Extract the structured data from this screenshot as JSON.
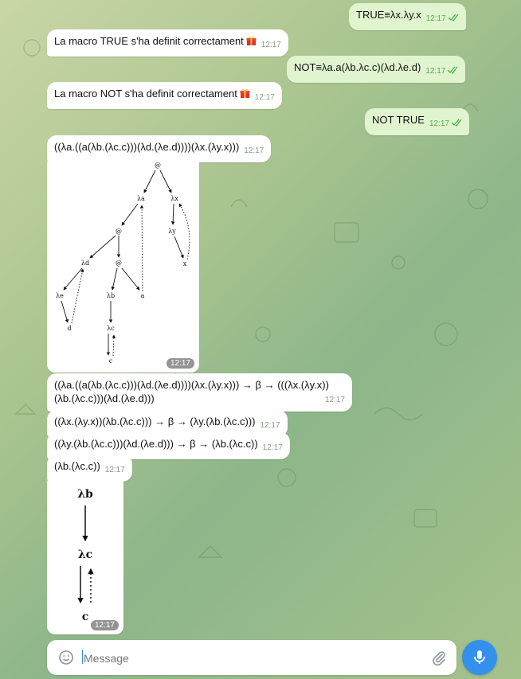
{
  "messages": [
    {
      "dir": "out",
      "text": "TRUE≡λx.λy.x",
      "time": "12:17"
    },
    {
      "dir": "in",
      "text": "La macro TRUE s'ha definit correctament",
      "time": "12:17"
    },
    {
      "dir": "out",
      "text": "NOT≡λa.a(λb.λc.c)(λd.λe.d)",
      "time": "12:17"
    },
    {
      "dir": "in",
      "text": "La macro NOT s'ha definit correctament",
      "time": "12:17"
    },
    {
      "dir": "out",
      "text": "NOT TRUE",
      "time": "12:17"
    },
    {
      "dir": "in",
      "text": "((λa.((a(λb.(λc.c)))(λd.(λe.d))))(λx.(λy.x)))",
      "time": "12:17"
    },
    {
      "dir": "in",
      "text": "((λa.((a(λb.(λc.c)))(λd.(λe.d))))(λx.(λy.x))) → β → (((λx.(λy.x))(λb.(λc.c)))(λd.(λe.d)))",
      "time": "12:17"
    },
    {
      "dir": "in",
      "text": "((λx.(λy.x))(λb.(λc.c))) → β → (λy.(λb.(λc.c)))",
      "time": "12:17"
    },
    {
      "dir": "in",
      "text": "((λy.(λb.(λc.c)))(λd.(λe.d))) → β → (λb.(λc.c))",
      "time": "12:17"
    },
    {
      "dir": "in",
      "text": "(λb.(λc.c))",
      "time": "12:17"
    }
  ],
  "tree1": {
    "time": "12:17",
    "labels": {
      "root": "@",
      "la": "λa",
      "lx": "λx",
      "ly": "λy",
      "x": "x",
      "app1": "@",
      "ld": "λd",
      "app2": "@",
      "le": "λe",
      "d": "d",
      "lb": "λb",
      "a": "a",
      "lc": "λc",
      "c": "c"
    }
  },
  "tree2": {
    "time": "12:17",
    "labels": {
      "lb": "λb",
      "lc": "λc",
      "c": "c"
    }
  },
  "composer": {
    "placeholder": "Message"
  },
  "icons": {
    "emoji": "smile-icon",
    "attach": "paperclip-icon",
    "mic": "microphone-icon",
    "read": "double-check-icon",
    "gift": "gift-icon"
  },
  "colors": {
    "outgoing": "#e0f5cf",
    "incoming": "#ffffff",
    "accent": "#3390ec",
    "check": "#4fae4e"
  }
}
